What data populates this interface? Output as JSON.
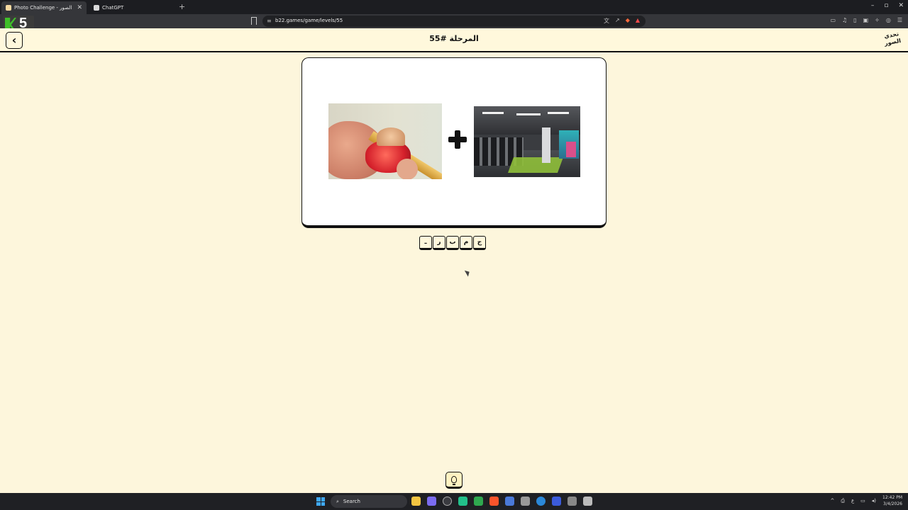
{
  "browser": {
    "tabs": [
      {
        "label": "Photo Challenge - تحدي الصور",
        "active": true
      },
      {
        "label": "ChatGPT",
        "active": false
      }
    ],
    "new_tab": "+",
    "window_controls": [
      "–",
      "▫",
      "✕"
    ],
    "url": "b22.games/game/levels/55",
    "overlay_badge": "5"
  },
  "header": {
    "back_icon": "‹",
    "title": "المرحلة #55",
    "logo_text": "تحدي الصور"
  },
  "puzzle": {
    "images": [
      "pencil-sharpener-photo",
      "gym-photo"
    ],
    "operator": "+",
    "answer_letters": [
      "ج",
      "م",
      "ب",
      "ر",
      "ـ"
    ]
  },
  "hint": {
    "icon": "lightbulb-icon"
  },
  "taskbar": {
    "search_placeholder": "Search",
    "time": "12:42 PM",
    "date": "3/4/2026",
    "lang": "ع"
  },
  "colors": {
    "page_bg": "#fdf6dc",
    "header_bg": "#fff8dc",
    "border": "#111111",
    "chrome": "#35363a"
  }
}
